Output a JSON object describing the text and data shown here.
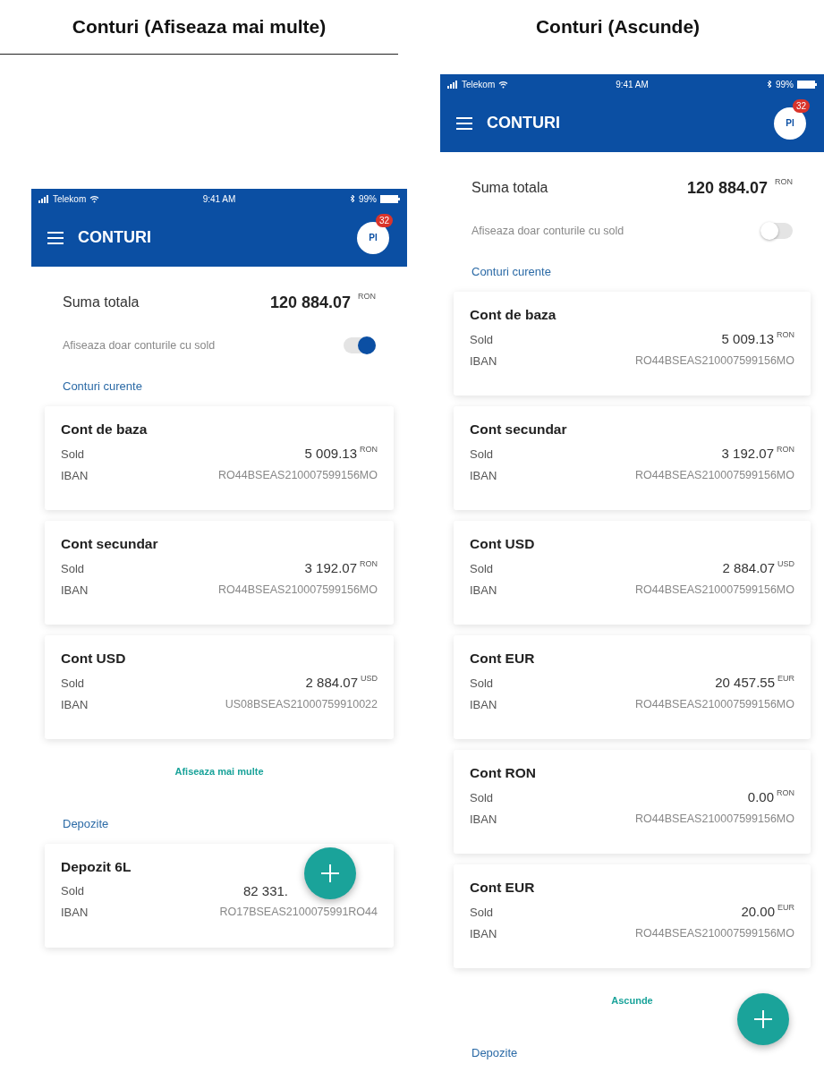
{
  "phones": [
    {
      "caption": "Conturi (Afiseaza mai multe)",
      "status_bar": {
        "carrier": "Telekom",
        "time": "9:41 AM",
        "battery": "99%"
      },
      "app_bar": {
        "title": "CONTURI",
        "avatar": "PI",
        "badge": "32"
      },
      "total": {
        "label": "Suma totala",
        "amount": "120 884.07",
        "currency": "RON"
      },
      "filter": {
        "label": "Afiseaza doar conturile cu sold",
        "on": true
      },
      "sections": [
        {
          "title": "Conturi curente",
          "accounts": [
            {
              "name": "Cont de baza",
              "sold_label": "Sold",
              "amount": "5 009.13",
              "currency": "RON",
              "iban_label": "IBAN",
              "iban": "RO44BSEAS210007599156MO"
            },
            {
              "name": "Cont secundar",
              "sold_label": "Sold",
              "amount": "3 192.07",
              "currency": "RON",
              "iban_label": "IBAN",
              "iban": "RO44BSEAS210007599156MO"
            },
            {
              "name": "Cont USD",
              "sold_label": "Sold",
              "amount": "2 884.07",
              "currency": "USD",
              "iban_label": "IBAN",
              "iban": "US08BSEAS21000759910022"
            }
          ],
          "more_link": "Afiseaza mai multe"
        },
        {
          "title": "Depozite",
          "accounts": [
            {
              "name": "Depozit 6L",
              "sold_label": "Sold",
              "amount": "82 331.",
              "iban_label": "IBAN",
              "iban": "RO17BSEAS2100075991RO44"
            }
          ]
        }
      ]
    },
    {
      "caption": "Conturi (Ascunde)",
      "status_bar": {
        "carrier": "Telekom",
        "time": "9:41 AM",
        "battery": "99%"
      },
      "app_bar": {
        "title": "CONTURI",
        "avatar": "PI",
        "badge": "32"
      },
      "total": {
        "label": "Suma totala",
        "amount": "120 884.07",
        "currency": "RON"
      },
      "filter": {
        "label": "Afiseaza doar conturile cu sold",
        "on": false
      },
      "sections": [
        {
          "title": "Conturi curente",
          "accounts": [
            {
              "name": "Cont de baza",
              "sold_label": "Sold",
              "amount": "5 009.13",
              "currency": "RON",
              "iban_label": "IBAN",
              "iban": "RO44BSEAS210007599156MO"
            },
            {
              "name": "Cont secundar",
              "sold_label": "Sold",
              "amount": "3 192.07",
              "currency": "RON",
              "iban_label": "IBAN",
              "iban": "RO44BSEAS210007599156MO"
            },
            {
              "name": "Cont USD",
              "sold_label": "Sold",
              "amount": "2 884.07",
              "currency": "USD",
              "iban_label": "IBAN",
              "iban": "RO44BSEAS210007599156MO"
            },
            {
              "name": "Cont EUR",
              "sold_label": "Sold",
              "amount": "20 457.55",
              "currency": "EUR",
              "iban_label": "IBAN",
              "iban": "RO44BSEAS210007599156MO"
            },
            {
              "name": "Cont RON",
              "sold_label": "Sold",
              "amount": "0.00",
              "currency": "RON",
              "iban_label": "IBAN",
              "iban": "RO44BSEAS210007599156MO"
            },
            {
              "name": "Cont EUR",
              "sold_label": "Sold",
              "amount": "20.00",
              "currency": "EUR",
              "iban_label": "IBAN",
              "iban": "RO44BSEAS210007599156MO"
            }
          ],
          "more_link": "Ascunde"
        },
        {
          "title": "Depozite"
        }
      ]
    }
  ]
}
